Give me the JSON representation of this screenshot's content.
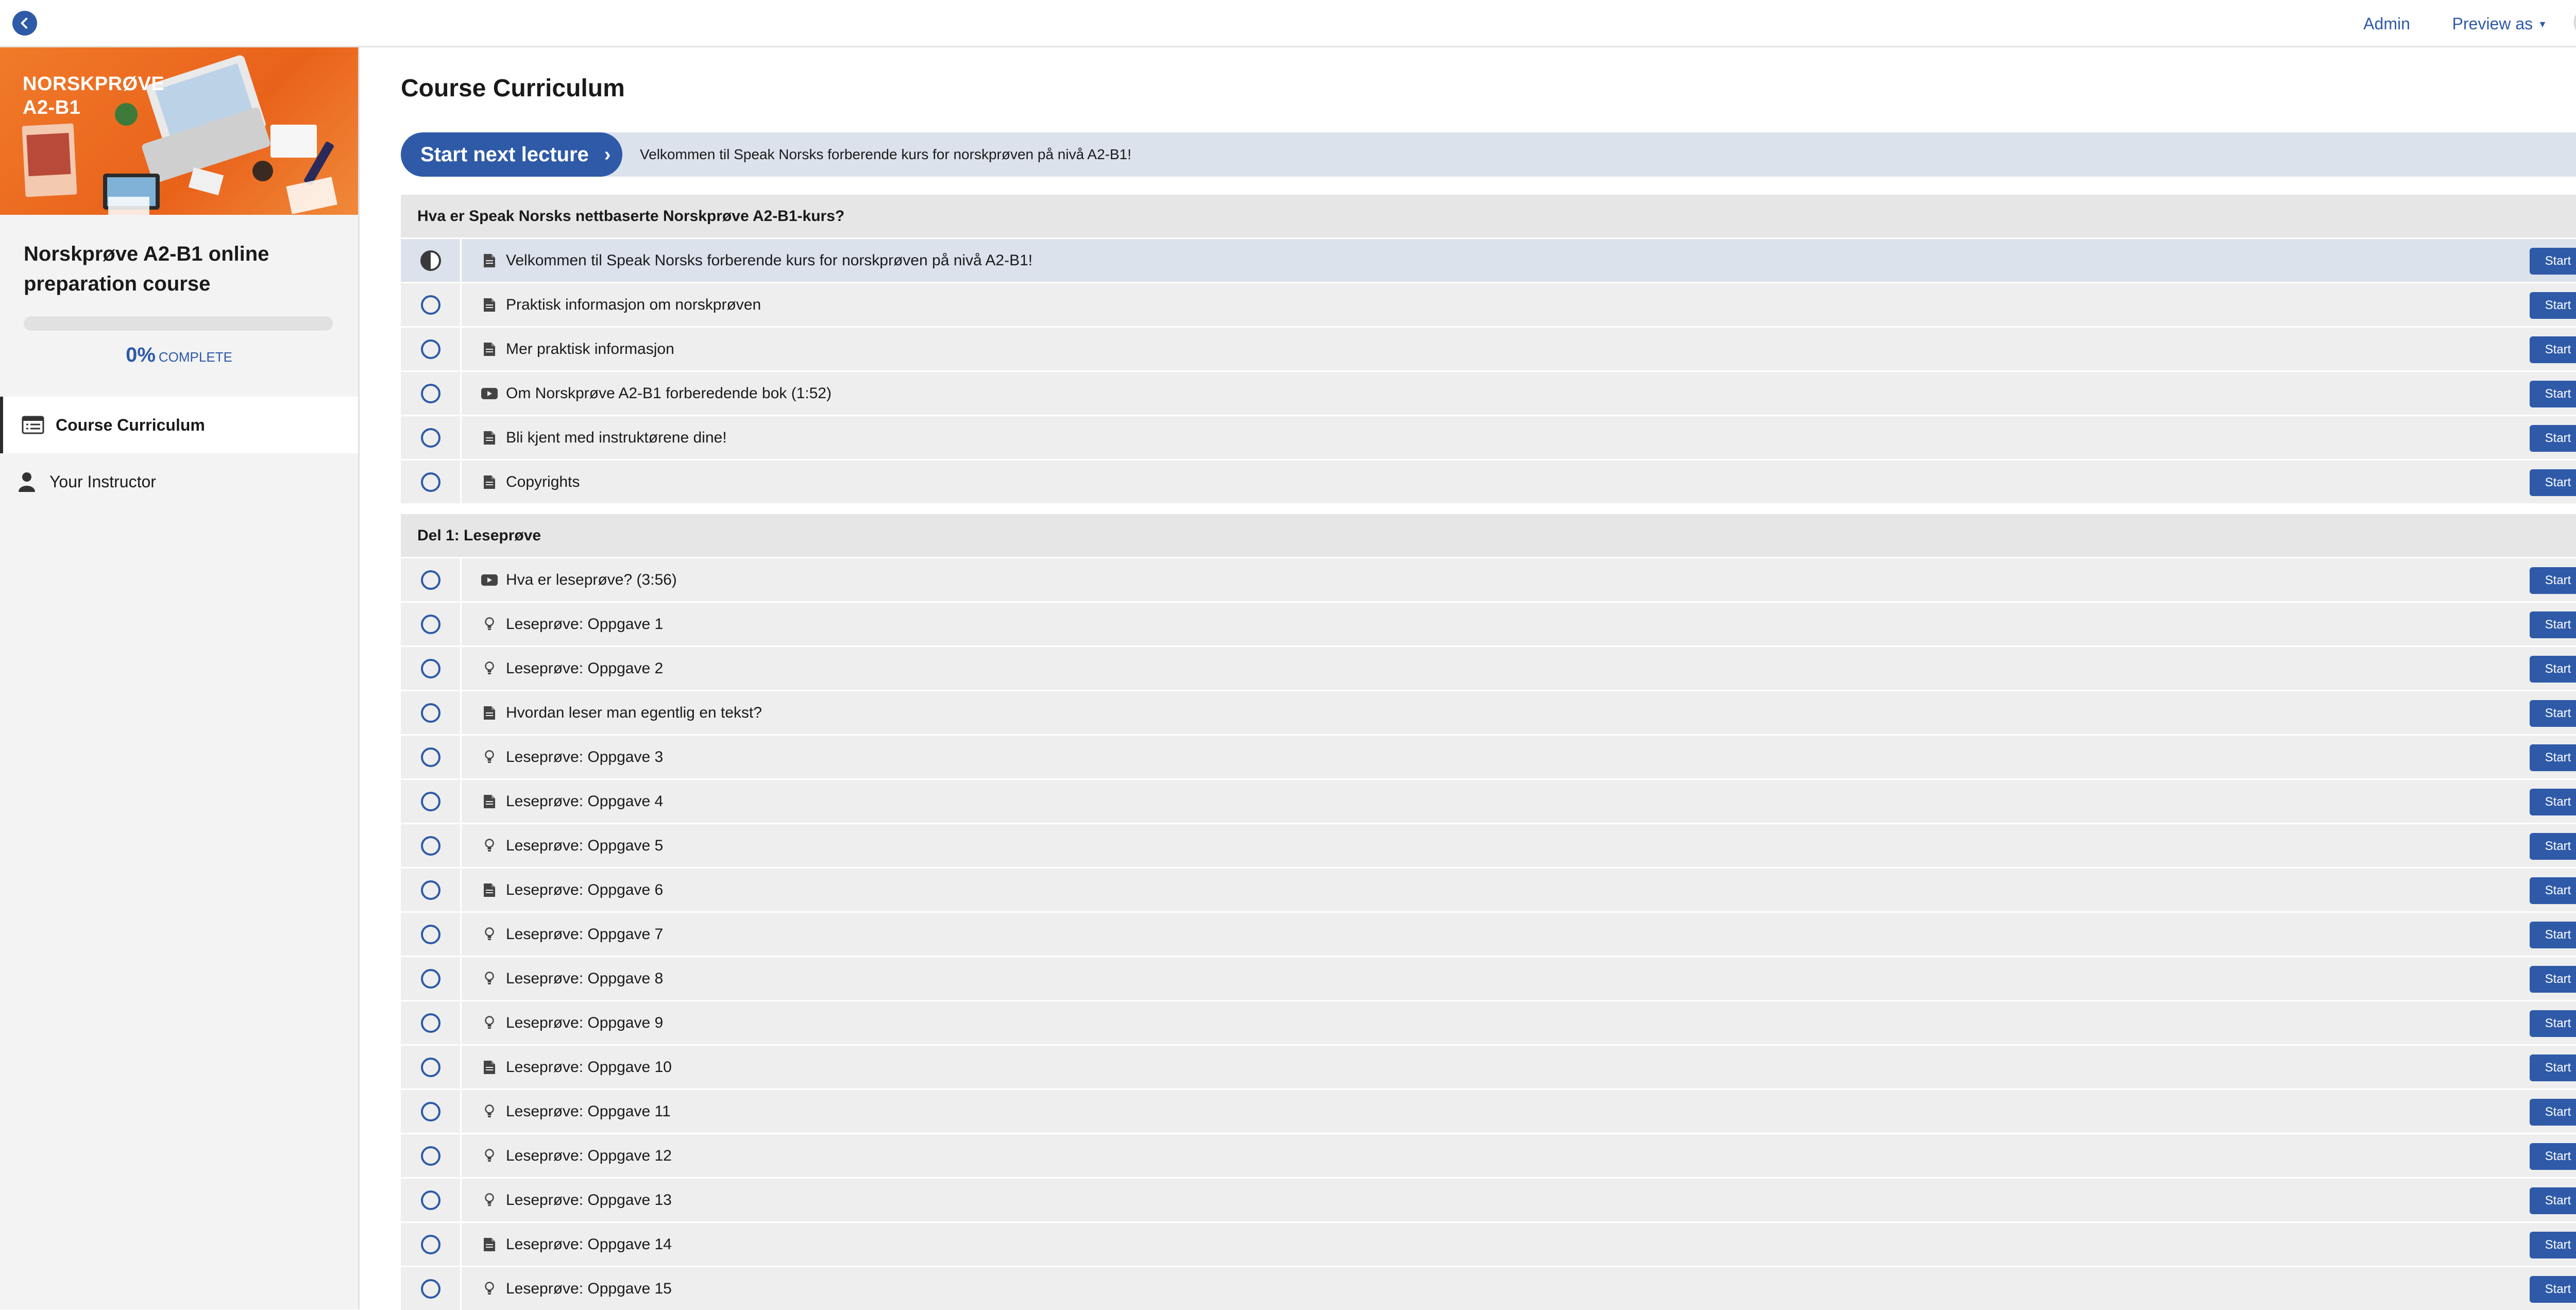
{
  "topbar": {
    "admin_label": "Admin",
    "preview_label": "Preview as"
  },
  "sidebar": {
    "image_title": "NORSKPRØVE\nA2-B1",
    "course_title": "Norskprøve A2-B1 online preparation course",
    "progress_percent": 0,
    "progress_pct_text": "0%",
    "progress_complete_label": "COMPLETE",
    "nav": [
      {
        "label": "Course Curriculum",
        "active": true
      },
      {
        "label": "Your Instructor",
        "active": false
      }
    ]
  },
  "main": {
    "title": "Course Curriculum",
    "next_lecture": {
      "button_label": "Start next lecture",
      "lecture_title": "Velkommen til Speak Norsks forberende kurs for norskprøven på nivå A2-B1!"
    },
    "start_label": "Start",
    "sections": [
      {
        "title": "Hva er Speak Norsks nettbaserte Norskprøve A2-B1-kurs?",
        "lectures": [
          {
            "title": "Velkommen til Speak Norsks forberende kurs for norskprøven på nivå A2-B1!",
            "type": "document",
            "status": "in-progress"
          },
          {
            "title": "Praktisk informasjon om norskprøven",
            "type": "document",
            "status": "not-started"
          },
          {
            "title": "Mer praktisk informasjon",
            "type": "document",
            "status": "not-started"
          },
          {
            "title": "Om Norskprøve A2-B1 forberedende bok (1:52)",
            "type": "video",
            "status": "not-started"
          },
          {
            "title": "Bli kjent med instruktørene dine!",
            "type": "document",
            "status": "not-started"
          },
          {
            "title": "Copyrights",
            "type": "document",
            "status": "not-started"
          }
        ]
      },
      {
        "title": "Del 1: Leseprøve",
        "lectures": [
          {
            "title": "Hva er leseprøve? (3:56)",
            "type": "video",
            "status": "not-started"
          },
          {
            "title": "Leseprøve: Oppgave 1",
            "type": "quiz",
            "status": "not-started"
          },
          {
            "title": "Leseprøve: Oppgave 2",
            "type": "quiz",
            "status": "not-started"
          },
          {
            "title": "Hvordan leser man egentlig en tekst?",
            "type": "document",
            "status": "not-started"
          },
          {
            "title": "Leseprøve: Oppgave 3",
            "type": "quiz",
            "status": "not-started"
          },
          {
            "title": "Leseprøve: Oppgave 4",
            "type": "document",
            "status": "not-started"
          },
          {
            "title": "Leseprøve: Oppgave 5",
            "type": "quiz",
            "status": "not-started"
          },
          {
            "title": "Leseprøve: Oppgave 6",
            "type": "document",
            "status": "not-started"
          },
          {
            "title": "Leseprøve: Oppgave 7",
            "type": "quiz",
            "status": "not-started"
          },
          {
            "title": "Leseprøve: Oppgave 8",
            "type": "quiz",
            "status": "not-started"
          },
          {
            "title": "Leseprøve: Oppgave 9",
            "type": "quiz",
            "status": "not-started"
          },
          {
            "title": "Leseprøve: Oppgave 10",
            "type": "document",
            "status": "not-started"
          },
          {
            "title": "Leseprøve: Oppgave 11",
            "type": "quiz",
            "status": "not-started"
          },
          {
            "title": "Leseprøve: Oppgave 12",
            "type": "quiz",
            "status": "not-started"
          },
          {
            "title": "Leseprøve: Oppgave 13",
            "type": "quiz",
            "status": "not-started"
          },
          {
            "title": "Leseprøve: Oppgave 14",
            "type": "document",
            "status": "not-started"
          },
          {
            "title": "Leseprøve: Oppgave 15",
            "type": "quiz",
            "status": "not-started"
          }
        ]
      }
    ]
  },
  "colors": {
    "accent": "#2e5aa8",
    "row_bg": "#eeeeee",
    "current_row_bg": "#dce2ec",
    "header_bg": "#e6e6e6",
    "brand_orange": "#f07a2a"
  }
}
